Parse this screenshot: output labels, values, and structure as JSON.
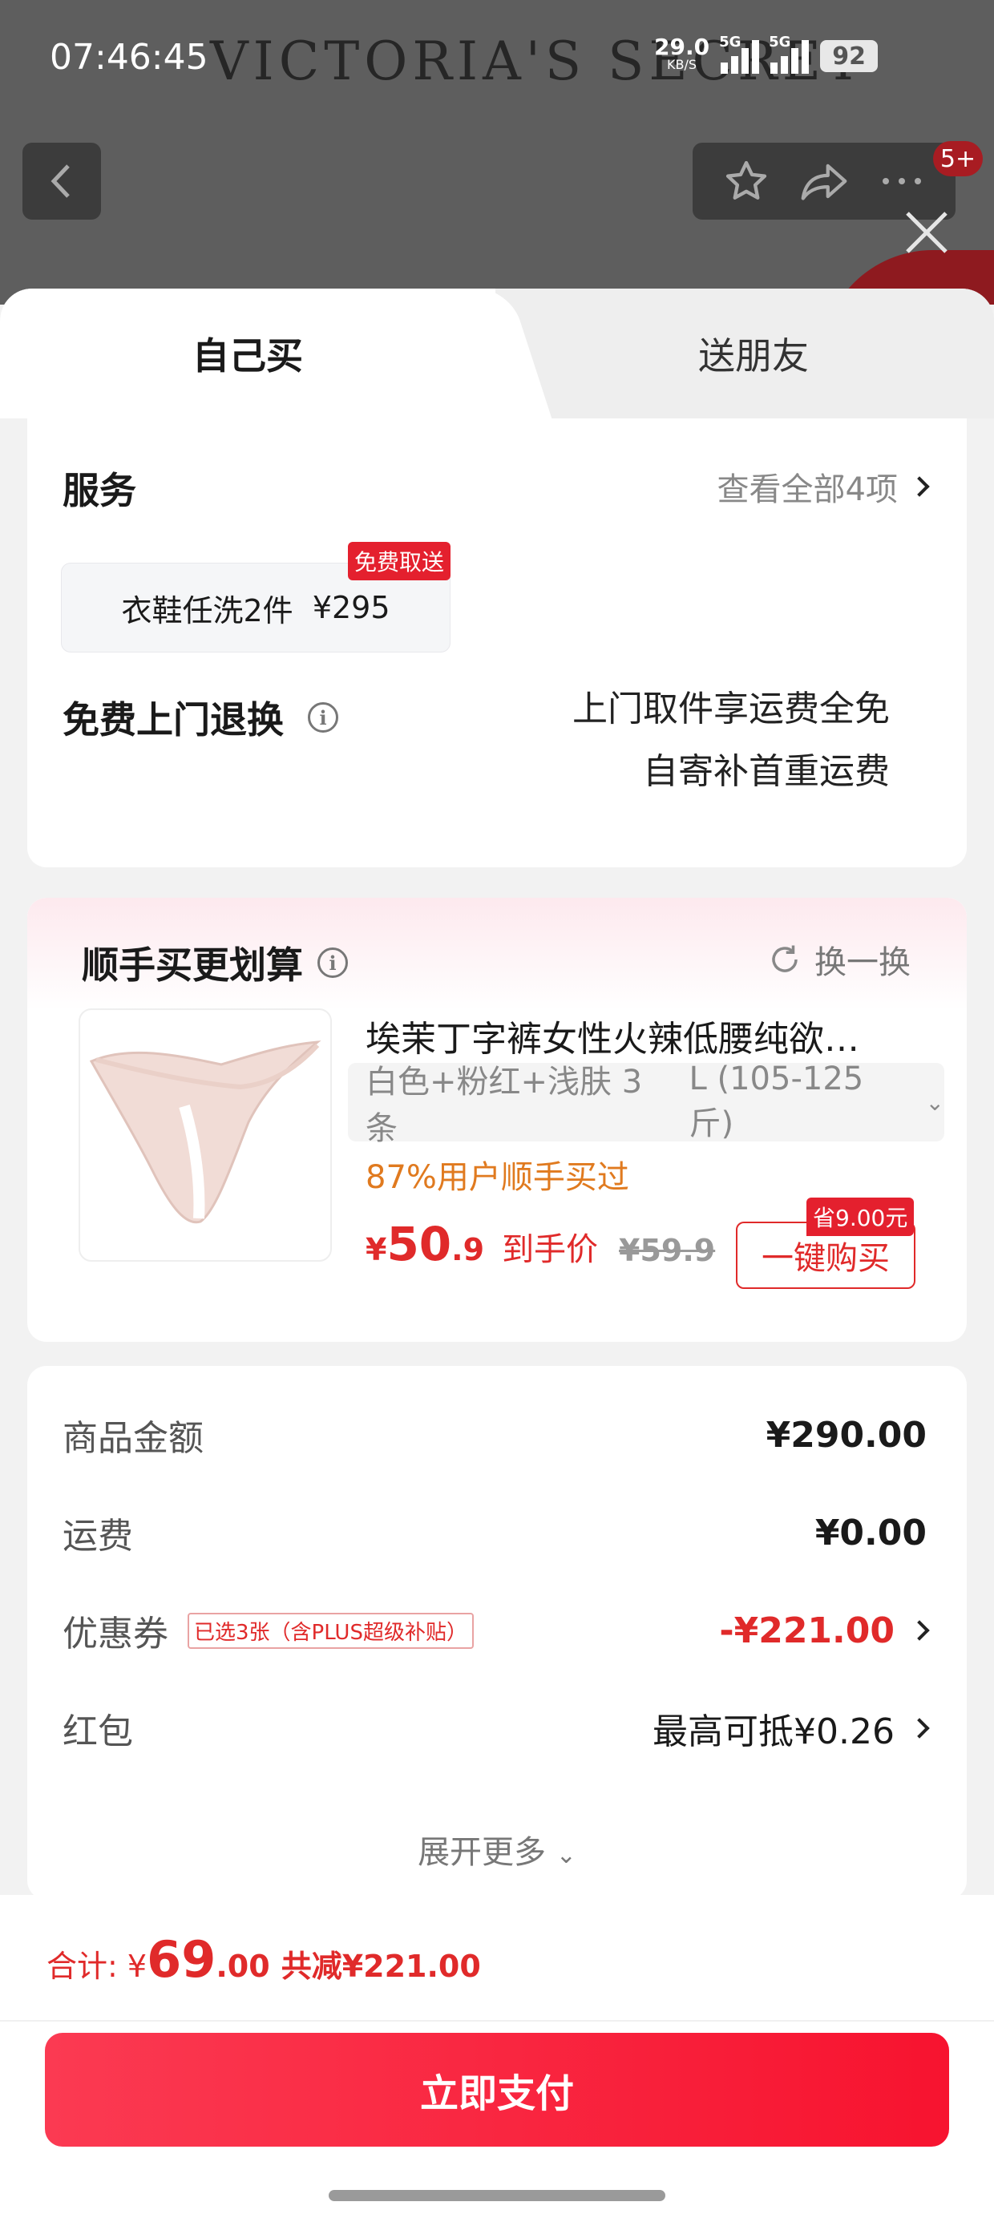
{
  "status_bar": {
    "time": "07:46:45",
    "speed": "29.0",
    "speed_unit": "KB/S",
    "network_1": "5G",
    "network_2": "5G",
    "battery": "92"
  },
  "background_page": {
    "brand": "VICTORIA'S SECRET",
    "notification_count": "5+"
  },
  "tabs": [
    {
      "label": "自己买",
      "active": true
    },
    {
      "label": "送朋友",
      "active": false
    }
  ],
  "services": {
    "title": "服务",
    "view_all": "查看全部4项",
    "chip_label": "衣鞋任洗2件",
    "chip_price": "¥295",
    "chip_badge": "免费取送",
    "return_title": "免费上门退换",
    "return_line_1": "上门取件享运费全免",
    "return_line_2": "自寄补首重运费"
  },
  "upsell": {
    "title": "顺手买更划算",
    "refresh_label": "换一换",
    "product_name": "埃茉丁字裤女性火辣低腰纯欲…",
    "variant": "白色+粉红+浅肤 3条",
    "size": "L (105-125斤)",
    "repurchase_rate": "87%用户顺手买过",
    "price_symbol": "¥",
    "price_int": "50",
    "price_dec": ".9",
    "price_label": "到手价",
    "original_price": "¥59.9",
    "save_badge": "省9.00元",
    "buy_button": "一键购买"
  },
  "summary": {
    "rows": [
      {
        "label": "商品金额",
        "value": "¥290.00"
      },
      {
        "label": "运费",
        "value": "¥0.00"
      },
      {
        "label": "优惠券",
        "tag": "已选3张（含PLUS超级补贴）",
        "value": "-¥221.00"
      },
      {
        "label": "红包",
        "value": "最高可抵¥0.26"
      }
    ],
    "expand_label": "展开更多"
  },
  "footer": {
    "total_label": "合计:",
    "total_symbol": "¥",
    "total_int": "69",
    "total_dec": ".00",
    "discount": "共减¥221.00",
    "pay_button": "立即支付"
  },
  "colors": {
    "accent_red": "#e02a2a",
    "badge_red": "#e4202e",
    "pay_gradient_start": "#fb3a52",
    "pay_gradient_end": "#f7132f",
    "rate_orange": "#e07a1f"
  },
  "icons": [
    "back-arrow-icon",
    "star-icon",
    "share-icon",
    "more-icon",
    "close-icon",
    "info-icon",
    "refresh-icon",
    "chevron-right-icon",
    "chevron-down-icon"
  ]
}
